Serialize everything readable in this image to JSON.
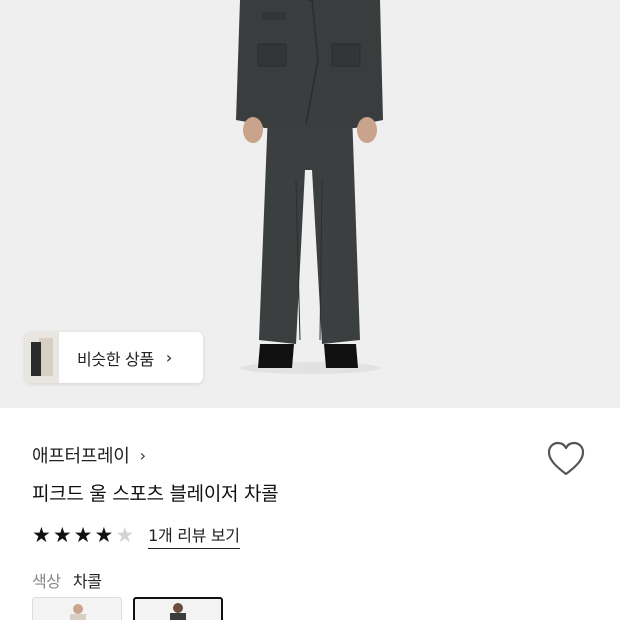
{
  "similar": {
    "label": "비슷한 상품",
    "chevron": "chevron-right-icon"
  },
  "product": {
    "brand": "애프터프레이",
    "brand_chevron": "chevron-right-icon",
    "title": "피크드 울 스포츠 블레이저 차콜",
    "rating": 4,
    "rating_max": 5,
    "review_link": "1개 리뷰 보기",
    "wishlist_icon": "heart-outline-icon"
  },
  "color": {
    "label": "색상",
    "value": "차콜"
  },
  "swatches": [
    {
      "name": "beige",
      "selected": false
    },
    {
      "name": "차콜",
      "selected": true
    }
  ],
  "colors": {
    "background": "#efefef",
    "text": "#111111",
    "muted": "#888888",
    "star_empty": "#d4d4d4"
  }
}
